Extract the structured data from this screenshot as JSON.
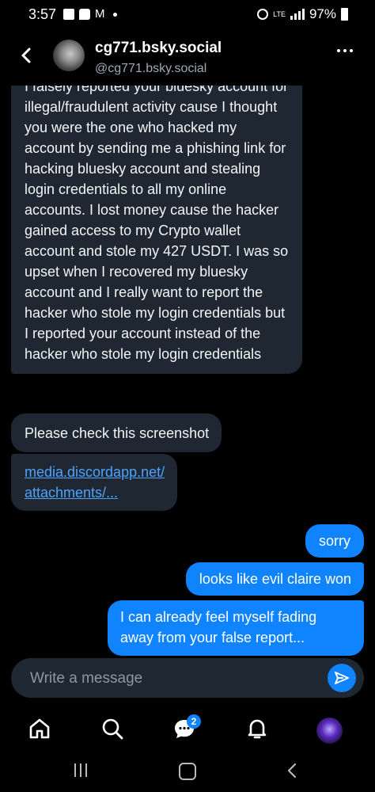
{
  "status_bar": {
    "time": "3:57",
    "network": "LTE",
    "battery": "97%"
  },
  "header": {
    "name": "cg771.bsky.social",
    "handle": "@cg771.bsky.social"
  },
  "messages": [
    {
      "direction": "incoming",
      "text": "I falsely reported your bluesky account for illegal/fraudulent activity cause I thought you were the one who hacked my account by sending me a phishing link for hacking bluesky  account and stealing login credentials to all my online accounts. I lost money cause the hacker gained access to my Crypto wallet account and stole my 427 USDT. I was so upset when I recovered my bluesky  account and I really want to report the hacker who stole my login credentials but I reported your account instead of the hacker who stole my login credentials"
    },
    {
      "direction": "incoming",
      "text": "Please check this screenshot"
    },
    {
      "direction": "incoming",
      "link_line1": "media.discordapp.net/",
      "link_line2": "attachments/..."
    },
    {
      "direction": "outgoing",
      "text": "sorry"
    },
    {
      "direction": "outgoing",
      "text": "looks like evil claire won"
    },
    {
      "direction": "outgoing",
      "text": "I can already feel myself fading away from your false report..."
    }
  ],
  "composer": {
    "placeholder": "Write a message"
  },
  "tabbar": {
    "items": [
      "home-icon",
      "search-icon",
      "chat-icon",
      "bell-icon",
      "profile-avatar"
    ],
    "chat_badge": "2"
  },
  "colors": {
    "accent": "#1083fe",
    "incoming_bubble": "#1e2732",
    "background": "#000000",
    "link": "#4ea3ff"
  }
}
